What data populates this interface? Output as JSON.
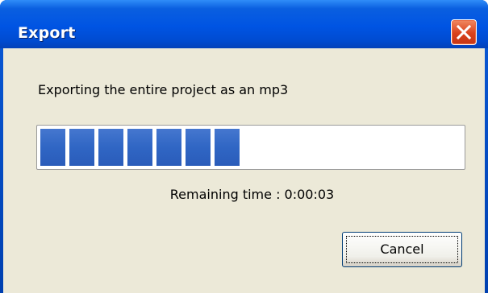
{
  "window": {
    "title": "Export"
  },
  "dialog": {
    "message": "Exporting the entire project as an mp3",
    "progress": {
      "fraction": 0.47,
      "segments_filled": 7
    },
    "remaining": "Remaining time : 0:00:03",
    "cancel_label": "Cancel"
  },
  "colors": {
    "titlebar": "#0054e3",
    "client_bg": "#ece9d8",
    "progress_fill": "#3066c4",
    "close_button": "#d9411c"
  },
  "icons": {
    "close": "close-icon"
  }
}
